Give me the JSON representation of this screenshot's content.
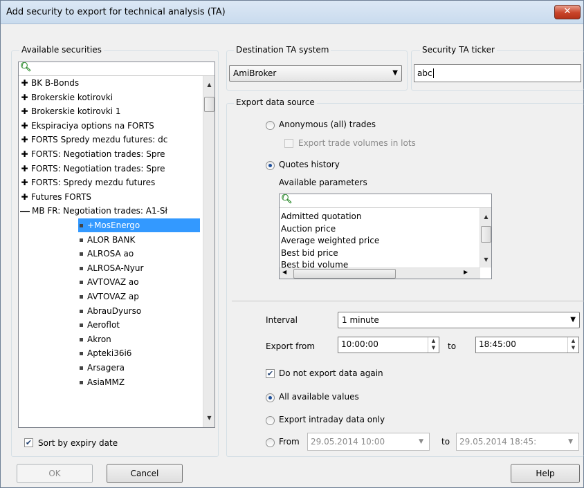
{
  "window": {
    "title": "Add security to export for technical analysis (TA)",
    "close_glyph": "✕"
  },
  "available_securities": {
    "legend": "Available securities",
    "search_value": "",
    "items": [
      {
        "label": "BK B-Bonds",
        "kind": "group"
      },
      {
        "label": "Brokerskie kotirovki",
        "kind": "group"
      },
      {
        "label": "Brokerskie kotirovki 1",
        "kind": "group"
      },
      {
        "label": "Ekspiraciya options na FORTS",
        "kind": "group"
      },
      {
        "label": "FORTS Spredy mezdu futures: dc",
        "kind": "group"
      },
      {
        "label": "FORTS: Negotiation trades: Spre",
        "kind": "group"
      },
      {
        "label": "FORTS: Negotiation trades: Spre",
        "kind": "group"
      },
      {
        "label": "FORTS: Spredy mezdu futures",
        "kind": "group"
      },
      {
        "label": "Futures FORTS",
        "kind": "group"
      },
      {
        "label": "MB FR: Negotiation trades: A1-Sł",
        "kind": "expanded"
      },
      {
        "label": "+MosEnergo",
        "kind": "leaf",
        "selected": true
      },
      {
        "label": "ALOR BANK",
        "kind": "leaf"
      },
      {
        "label": "ALROSA ao",
        "kind": "leaf"
      },
      {
        "label": "ALROSA-Nyur",
        "kind": "leaf"
      },
      {
        "label": "AVTOVAZ ao",
        "kind": "leaf"
      },
      {
        "label": "AVTOVAZ ap",
        "kind": "leaf"
      },
      {
        "label": "AbrauDyurso",
        "kind": "leaf"
      },
      {
        "label": "Aeroflot",
        "kind": "leaf"
      },
      {
        "label": "Akron",
        "kind": "leaf"
      },
      {
        "label": "Apteki36i6",
        "kind": "leaf"
      },
      {
        "label": "Arsagera",
        "kind": "leaf"
      },
      {
        "label": "AsiaMMZ",
        "kind": "leaf"
      }
    ],
    "sort_label": "Sort by expiry date",
    "sort_checked": true
  },
  "destination": {
    "legend": "Destination TA system",
    "value": "AmiBroker"
  },
  "ticker": {
    "legend": "Security TA ticker",
    "value": "abc"
  },
  "export_source": {
    "legend": "Export data source",
    "anonymous_label": "Anonymous (all) trades",
    "lots_label": "Export trade volumes in lots",
    "quotes_label": "Quotes history",
    "params_label": "Available parameters",
    "params_search": "",
    "params": [
      "Admitted quotation",
      "Auction price",
      "Average weighted price",
      "Best bid price",
      "Best bid volume"
    ]
  },
  "options": {
    "interval_label": "Interval",
    "interval_value": "1 minute",
    "export_from_label": "Export from",
    "from_time": "10:00:00",
    "to_label": "to",
    "to_time": "18:45:00",
    "no_again_label": "Do not export data again",
    "all_values_label": "All available values",
    "intraday_label": "Export intraday data only",
    "from_label": "From",
    "from_date": "29.05.2014 10:00",
    "to_label2": "to",
    "to_date": "29.05.2014 18:45:"
  },
  "buttons": {
    "ok": "OK",
    "cancel": "Cancel",
    "help": "Help"
  },
  "icons": {
    "search": "search-icon",
    "check": "✔"
  }
}
